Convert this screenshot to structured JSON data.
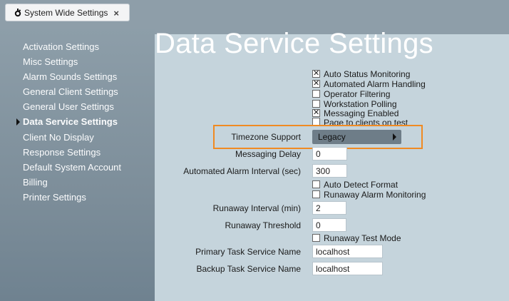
{
  "tab": {
    "title": "System Wide Settings",
    "close": "×",
    "icon": "gear-icon"
  },
  "sidebar": {
    "items": [
      {
        "label": "Activation Settings"
      },
      {
        "label": "Misc Settings"
      },
      {
        "label": "Alarm Sounds Settings"
      },
      {
        "label": "General Client Settings"
      },
      {
        "label": "General User Settings"
      },
      {
        "label": "Data Service Settings",
        "active": true
      },
      {
        "label": "Client No Display"
      },
      {
        "label": "Response Settings"
      },
      {
        "label": "Default System Account"
      },
      {
        "label": "Billing"
      },
      {
        "label": "Printer Settings"
      }
    ]
  },
  "main": {
    "title": "Data Service Settings",
    "checkboxes_top": [
      {
        "label": "Auto Status Monitoring",
        "checked": true
      },
      {
        "label": "Automated Alarm Handling",
        "checked": true
      },
      {
        "label": "Operator Filtering",
        "checked": false
      },
      {
        "label": "Workstation Polling",
        "checked": false
      },
      {
        "label": "Messaging Enabled",
        "checked": true
      },
      {
        "label": "Page to clients on test",
        "checked": false
      }
    ],
    "timezone": {
      "label": "Timezone Support",
      "value": "Legacy"
    },
    "messaging_delay": {
      "label": "Messaging Delay",
      "value": "0"
    },
    "automated_alarm_interval": {
      "label": "Automated Alarm Interval (sec)",
      "value": "300"
    },
    "checkboxes_mid": [
      {
        "label": "Auto Detect Format",
        "checked": false
      },
      {
        "label": "Runaway Alarm Monitoring",
        "checked": false
      }
    ],
    "runaway_interval": {
      "label": "Runaway Interval (min)",
      "value": "2"
    },
    "runaway_threshold": {
      "label": "Runaway Threshold",
      "value": "0"
    },
    "runaway_test_mode": {
      "label": "Runaway Test Mode",
      "checked": false
    },
    "primary_task_service": {
      "label": "Primary Task Service Name",
      "value": "localhost"
    },
    "backup_task_service": {
      "label": "Backup Task Service Name",
      "value": "localhost"
    }
  },
  "colors": {
    "highlight": "#f08a22",
    "panel": "#c5d4dc",
    "sidebar": "#8e9ea9"
  }
}
